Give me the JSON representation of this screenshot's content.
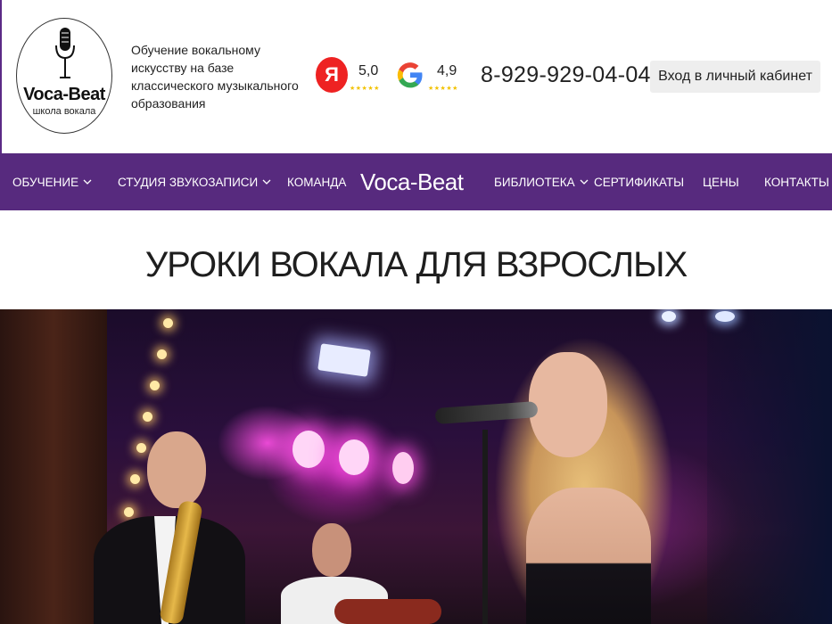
{
  "header": {
    "logo": {
      "title": "Voca-Beat",
      "subtitle": "школа вокала"
    },
    "tagline": "Обучение вокальному искусству на базе классического музыкального образования",
    "ratings": [
      {
        "source": "Yandex",
        "icon": "yandex-icon",
        "letter": "Я",
        "score": "5,0",
        "stars": "★★★★★"
      },
      {
        "source": "Google",
        "icon": "google-icon",
        "letter": "G",
        "score": "4,9",
        "stars": "★★★★★"
      }
    ],
    "phone": "8-929-929-04-04",
    "login_label": "Вход в личный кабинет"
  },
  "nav": {
    "items": [
      {
        "label": "ОБУЧЕНИЕ",
        "has_dropdown": true
      },
      {
        "label": "СТУДИЯ ЗВУКОЗАПИСИ",
        "has_dropdown": true
      },
      {
        "label": "КОМАНДА",
        "has_dropdown": false
      },
      {
        "label": "БИБЛИОТЕКА",
        "has_dropdown": true
      },
      {
        "label": "СЕРТИФИКАТЫ",
        "has_dropdown": false
      },
      {
        "label": "ЦЕНЫ",
        "has_dropdown": false
      },
      {
        "label": "КОНТАКТЫ",
        "has_dropdown": false
      }
    ],
    "logo": "Voca-Beat"
  },
  "main": {
    "title": "УРОКИ ВОКАЛА ДЛЯ ВЗРОСЛЫХ"
  },
  "colors": {
    "nav_bg": "#572a7e",
    "login_bg": "#eeeeee",
    "yandex_red": "#e22222",
    "star_gold": "#f2c200"
  }
}
